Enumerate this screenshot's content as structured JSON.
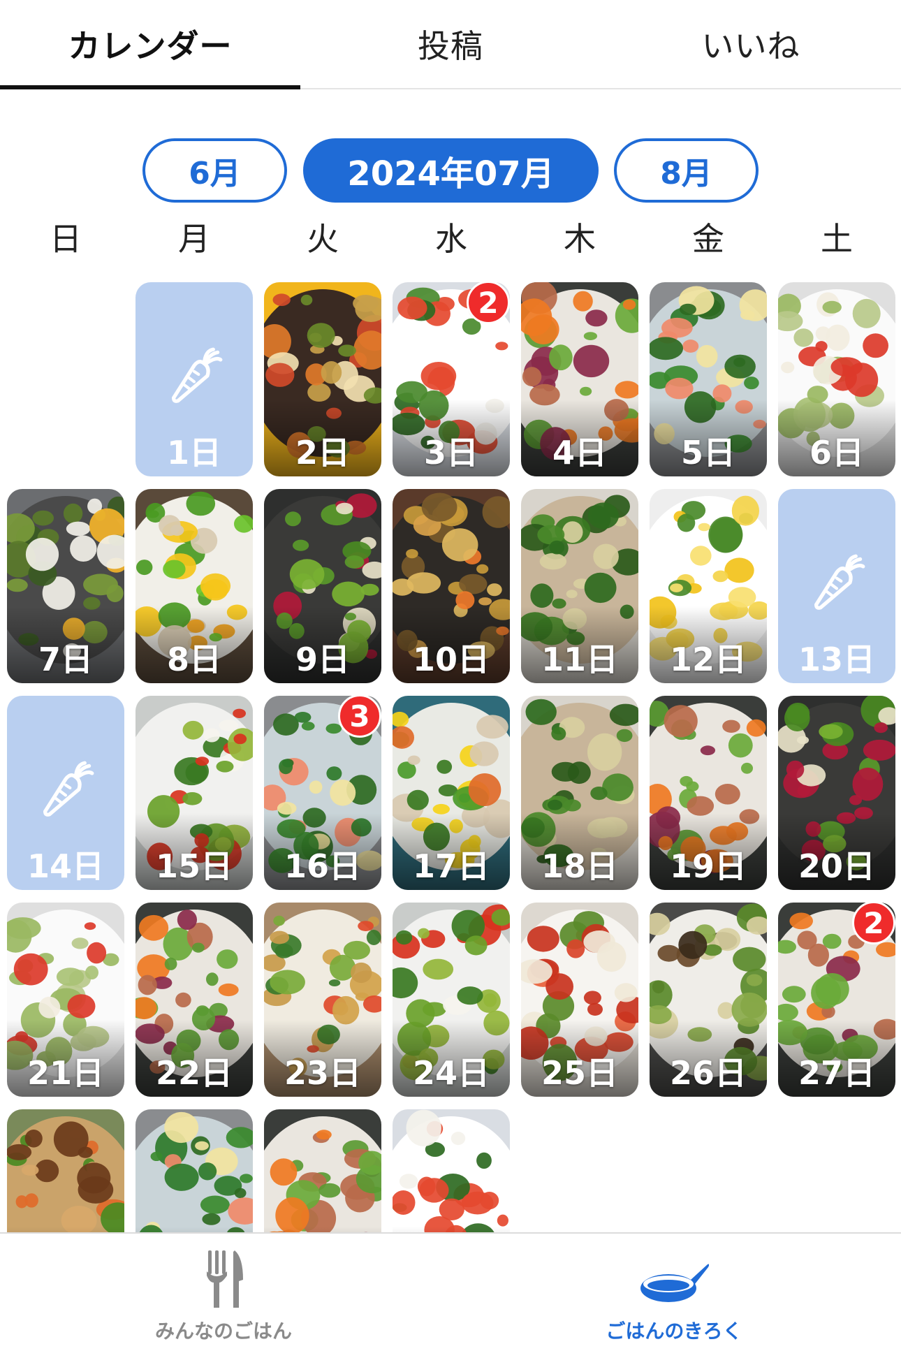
{
  "tabs": [
    {
      "label": "カレンダー",
      "active": true
    },
    {
      "label": "投稿",
      "active": false
    },
    {
      "label": "いいね",
      "active": false
    }
  ],
  "months": {
    "prev": "6月",
    "current": "2024年07月",
    "next": "8月"
  },
  "weekdays": [
    "日",
    "月",
    "火",
    "水",
    "木",
    "金",
    "土"
  ],
  "colors": {
    "accent": "#1f6bd6",
    "badge": "#ef2b2b",
    "empty_day": "#b9cff0"
  },
  "days": [
    {
      "label": "1日",
      "empty": true,
      "col": 1,
      "row": 0
    },
    {
      "label": "2日",
      "theme": "bowl-yellow",
      "col": 2,
      "row": 0
    },
    {
      "label": "3日",
      "theme": "caprese",
      "badge": "2",
      "col": 3,
      "row": 0
    },
    {
      "label": "4日",
      "theme": "chicken-salad",
      "col": 4,
      "row": 0
    },
    {
      "label": "5日",
      "theme": "salmon-broccoli",
      "col": 5,
      "row": 0
    },
    {
      "label": "6日",
      "theme": "pasta-white",
      "col": 6,
      "row": 0
    },
    {
      "label": "7日",
      "theme": "avocado-toast",
      "col": 0,
      "row": 1
    },
    {
      "label": "8日",
      "theme": "greens-mushroom",
      "col": 1,
      "row": 1
    },
    {
      "label": "9日",
      "theme": "beet-salad",
      "col": 2,
      "row": 1
    },
    {
      "label": "10日",
      "theme": "fried-rice",
      "col": 3,
      "row": 1
    },
    {
      "label": "11日",
      "theme": "spinach-toast",
      "col": 4,
      "row": 1
    },
    {
      "label": "12日",
      "theme": "corn-soup",
      "col": 5,
      "row": 1
    },
    {
      "label": "13日",
      "empty": true,
      "col": 6,
      "row": 1
    },
    {
      "label": "14日",
      "empty": true,
      "col": 0,
      "row": 2
    },
    {
      "label": "15日",
      "theme": "egg-asparagus",
      "col": 1,
      "row": 2
    },
    {
      "label": "16日",
      "theme": "salmon-broccoli",
      "badge": "3",
      "col": 2,
      "row": 2
    },
    {
      "label": "17日",
      "theme": "grain-bowl",
      "col": 3,
      "row": 2
    },
    {
      "label": "18日",
      "theme": "spinach-toast",
      "col": 4,
      "row": 2
    },
    {
      "label": "19日",
      "theme": "chicken-salad",
      "col": 5,
      "row": 2
    },
    {
      "label": "20日",
      "theme": "beet-salad",
      "col": 6,
      "row": 2
    },
    {
      "label": "21日",
      "theme": "pasta-white",
      "col": 0,
      "row": 3
    },
    {
      "label": "22日",
      "theme": "chicken-salad",
      "col": 1,
      "row": 3
    },
    {
      "label": "23日",
      "theme": "two-bowls",
      "col": 2,
      "row": 3
    },
    {
      "label": "24日",
      "theme": "egg-asparagus",
      "col": 3,
      "row": 3
    },
    {
      "label": "25日",
      "theme": "kimchi",
      "col": 4,
      "row": 3
    },
    {
      "label": "26日",
      "theme": "patties",
      "col": 5,
      "row": 3
    },
    {
      "label": "27日",
      "theme": "chicken-salad",
      "badge": "2",
      "col": 6,
      "row": 3
    },
    {
      "label": "",
      "theme": "tofu-nuts",
      "col": 0,
      "row": 4
    },
    {
      "label": "",
      "theme": "salmon-broccoli",
      "col": 1,
      "row": 4
    },
    {
      "label": "",
      "theme": "chicken-salad",
      "col": 2,
      "row": 4
    },
    {
      "label": "",
      "theme": "caprese",
      "col": 3,
      "row": 4
    }
  ],
  "bottom_nav": [
    {
      "label": "みんなのごはん",
      "icon": "fork-knife-icon",
      "active": false
    },
    {
      "label": "ごはんのきろく",
      "icon": "frying-pan-icon",
      "active": true
    }
  ]
}
